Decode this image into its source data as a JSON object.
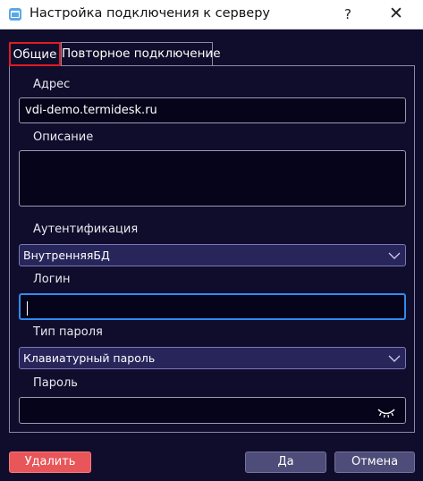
{
  "window": {
    "title": "Настройка подключения к серверу",
    "help_label": "?",
    "close_label": "✕"
  },
  "tabs": [
    {
      "label": "Общие",
      "active": true
    },
    {
      "label": "Повторное подключение",
      "active": false
    }
  ],
  "form": {
    "address": {
      "label": "Адрес",
      "value": "vdi-demo.termidesk.ru"
    },
    "description": {
      "label": "Описание",
      "value": ""
    },
    "auth": {
      "label": "Аутентификация",
      "value": "ВнутренняяБД"
    },
    "login": {
      "label": "Логин",
      "value": ""
    },
    "password_type": {
      "label": "Тип пароля",
      "value": "Клавиатурный пароль"
    },
    "password": {
      "label": "Пароль",
      "value": ""
    }
  },
  "buttons": {
    "delete": "Удалить",
    "ok": "Да",
    "cancel": "Отмена"
  },
  "icons": {
    "app": "app-window-icon",
    "combo": "chevron-down-icon",
    "password_visibility": "eye-closed-icon"
  },
  "colors": {
    "background": "#0f0d2b",
    "active_tab_highlight": "#e01b24",
    "focus": "#2f8cf2",
    "delete_button": "#e85659",
    "primary_button": "#4e4c78"
  }
}
